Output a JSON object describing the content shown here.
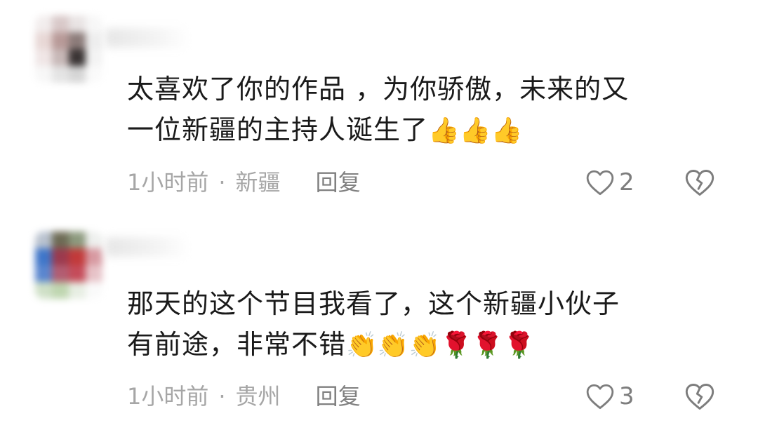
{
  "comments": [
    {
      "text_line1": "太喜欢了你的作品 ，为你骄傲，未来的又",
      "text_line2": "一位新疆的主持人诞生了",
      "emojis": "👍👍👍",
      "time": "1小时前",
      "separator": "·",
      "location": "新疆",
      "reply_label": "回复",
      "like_count": "2",
      "icons": {
        "like": "heart-outline-icon",
        "dislike": "broken-heart-icon"
      }
    },
    {
      "text_line1": "那天的这个节目我看了，这个新疆小伙子",
      "text_line2": "有前途，非常不错",
      "emojis": "👏👏👏🌹🌹🌹",
      "time": "1小时前",
      "separator": "·",
      "location": "贵州",
      "reply_label": "回复",
      "like_count": "3",
      "icons": {
        "like": "heart-outline-icon",
        "dislike": "broken-heart-icon"
      }
    }
  ],
  "colors": {
    "text": "#1a1a1a",
    "meta": "#a6a6a6",
    "icon": "#7d7d7d",
    "background": "#ffffff"
  }
}
